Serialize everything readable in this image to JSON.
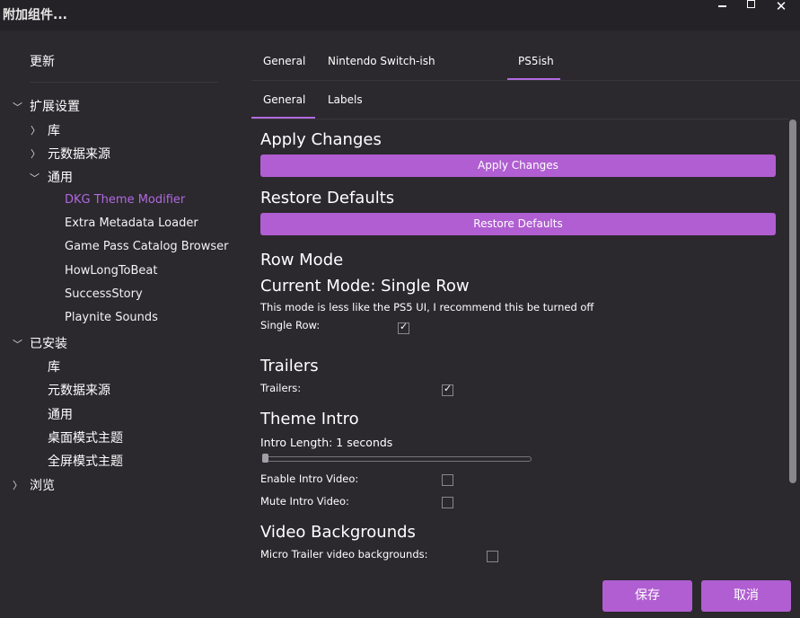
{
  "window": {
    "title": "附加组件..."
  },
  "sidebar": {
    "update": "更新",
    "ext_settings": "扩展设置",
    "ext_items": {
      "library": "库",
      "metadata": "元数据来源",
      "general": "通用"
    },
    "general_items": [
      "DKG Theme Modifier",
      "Extra Metadata Loader",
      "Game Pass Catalog Browser",
      "HowLongToBeat",
      "SuccessStory",
      "Playnite Sounds"
    ],
    "installed": "已安装",
    "installed_items": [
      "库",
      "元数据来源",
      "通用",
      "桌面模式主题",
      "全屏模式主题"
    ],
    "browse": "浏览"
  },
  "tabs_top": [
    "General",
    "Nintendo Switch-ish",
    "PS5ish"
  ],
  "tabs_sub": [
    "General",
    "Labels"
  ],
  "content": {
    "apply_heading": "Apply Changes",
    "apply_button": "Apply Changes",
    "restore_heading": "Restore Defaults",
    "restore_button": "Restore Defaults",
    "row_mode_heading": "Row Mode",
    "current_mode": "Current Mode: Single Row",
    "row_mode_note": "This mode is less like the PS5 UI, I recommend this be turned off",
    "single_row_label": "Single Row:",
    "trailers_heading": "Trailers",
    "trailers_label": "Trailers:",
    "theme_intro_heading": "Theme Intro",
    "intro_length": "Intro Length: 1 seconds",
    "enable_intro_label": "Enable Intro Video:",
    "mute_intro_label": "Mute Intro Video:",
    "video_bg_heading": "Video Backgrounds",
    "micro_trailer_label": "Micro Trailer video backgrounds:",
    "checkboxes": {
      "single_row": true,
      "trailers": true,
      "enable_intro": false,
      "mute_intro": false,
      "micro_trailer": false
    },
    "intro_slider_fraction": 0.0
  },
  "footer": {
    "save": "保存",
    "cancel": "取消"
  },
  "colors": {
    "accent": "#b05ed1",
    "active_text": "#b06adf",
    "background": "#2b282e"
  }
}
